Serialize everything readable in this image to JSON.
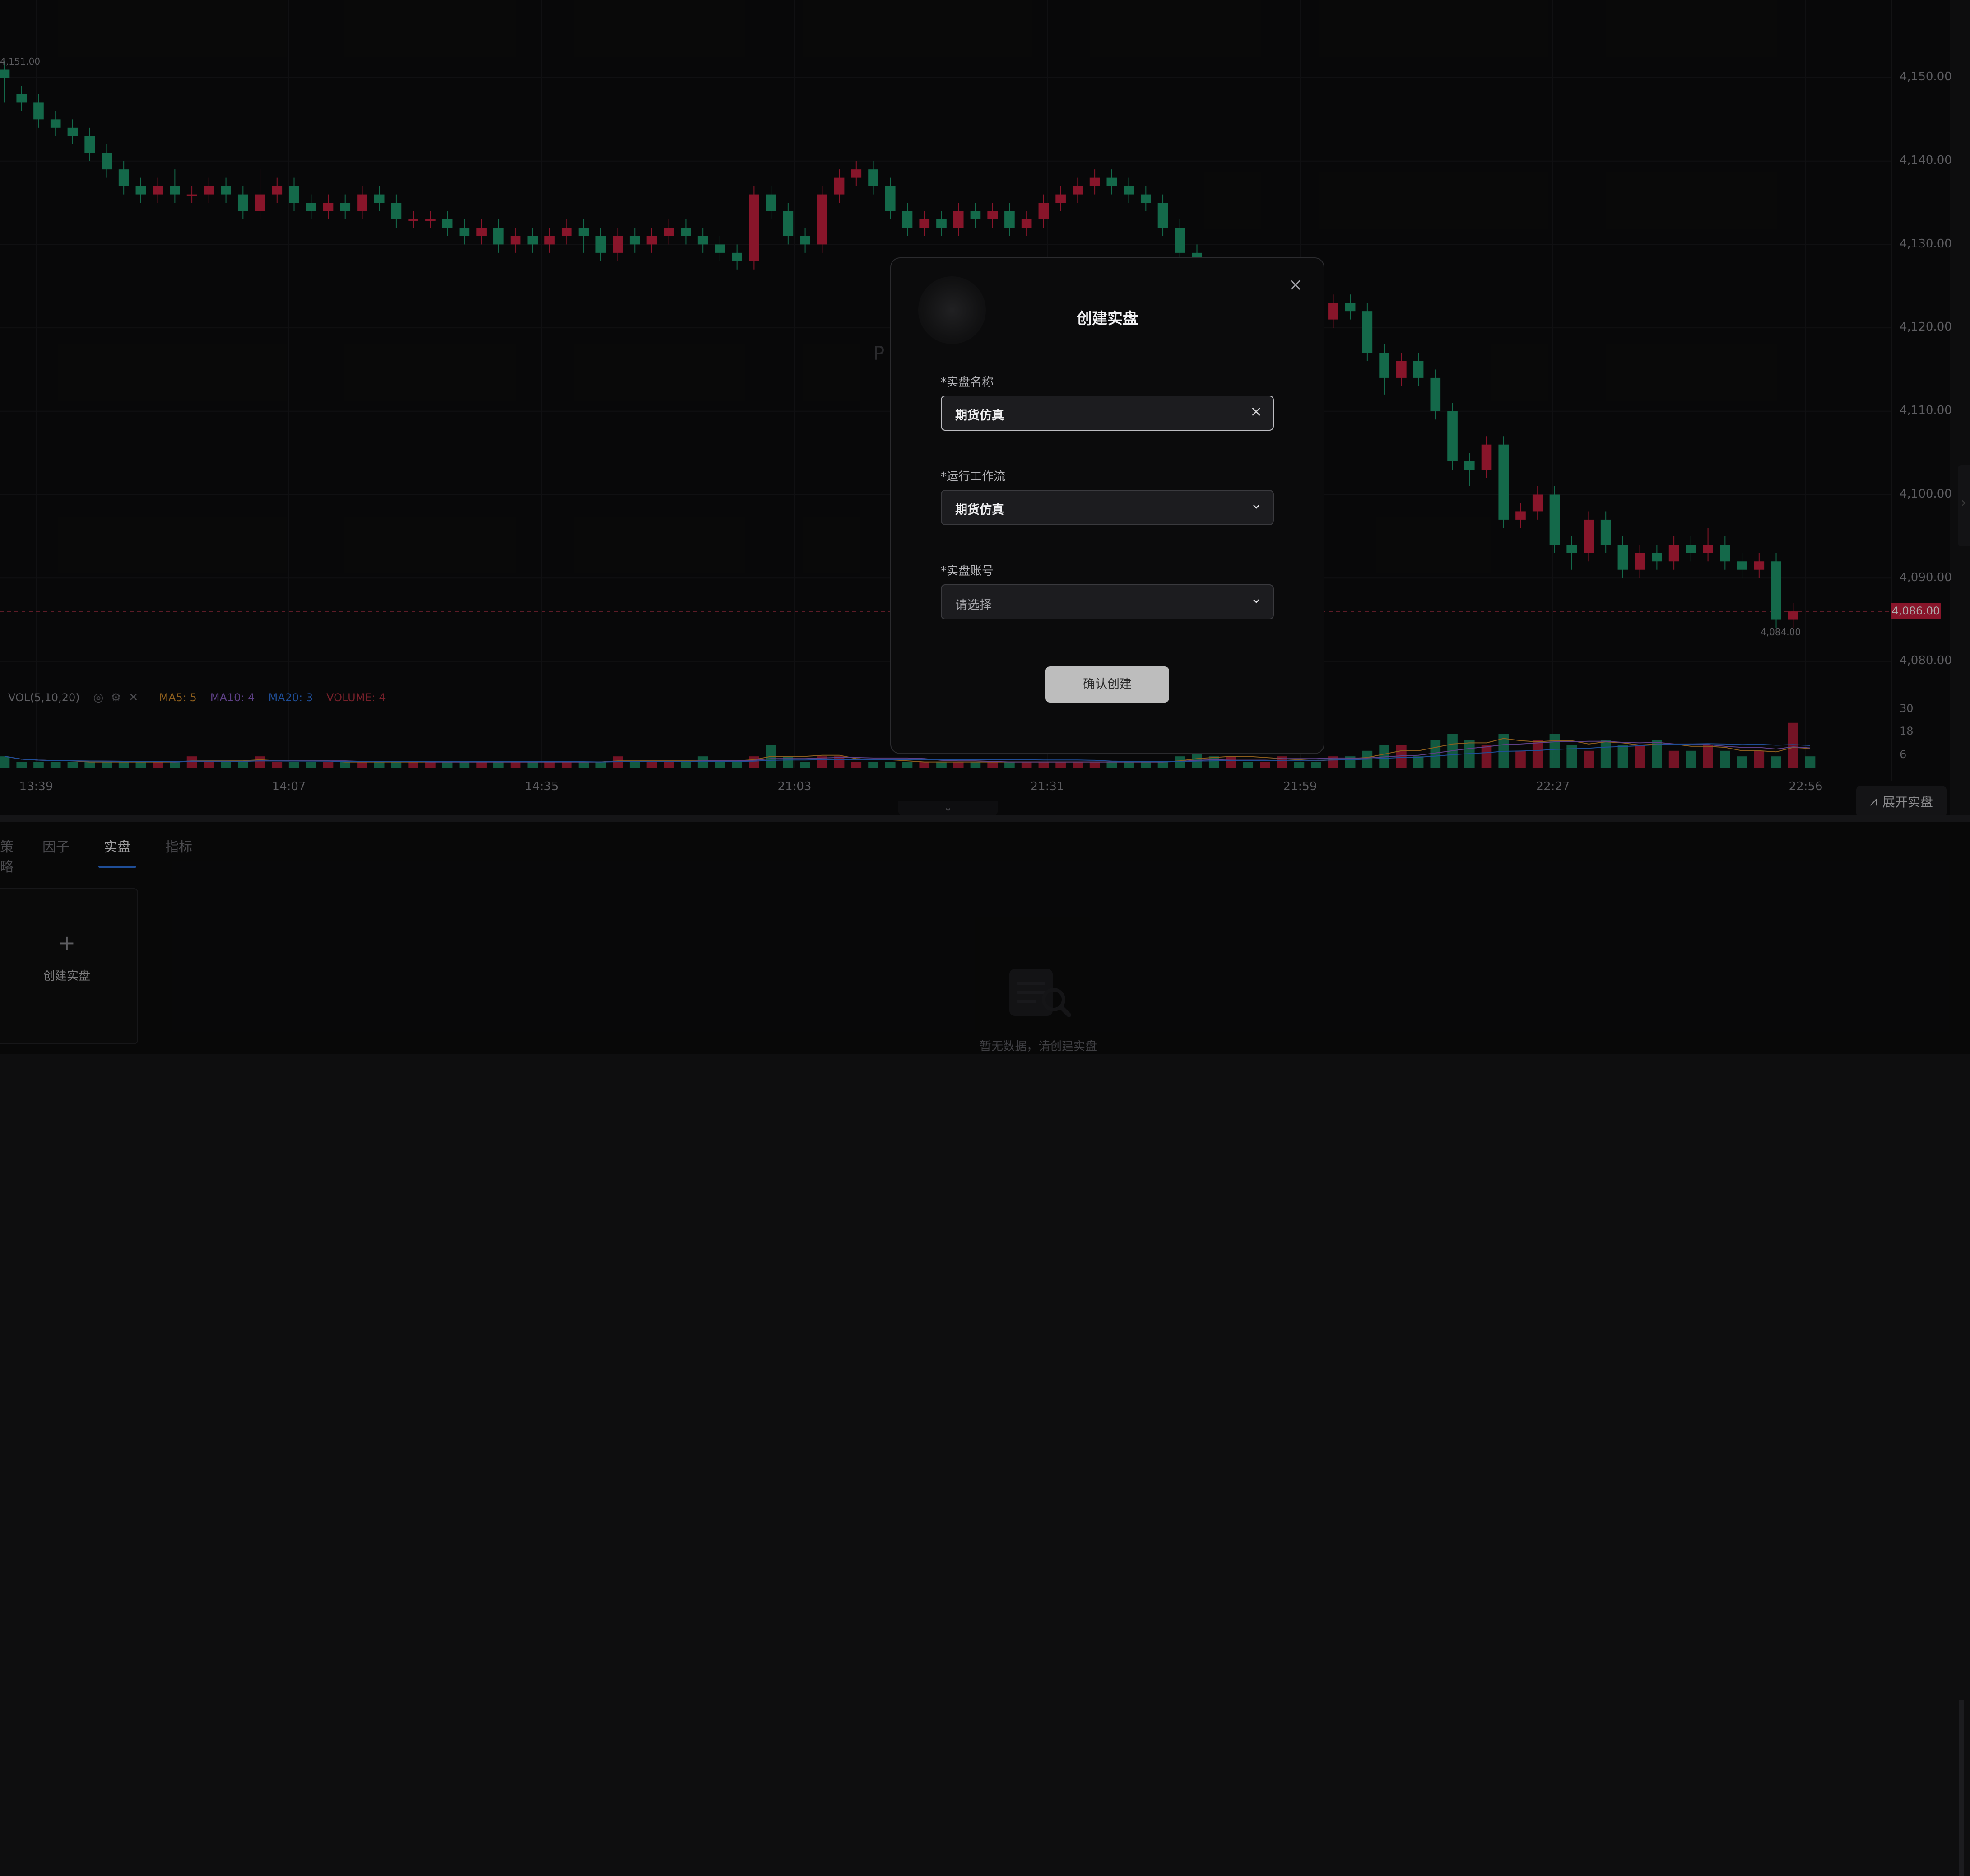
{
  "chart": {
    "high_tag": "4,151.00",
    "low_tag": "4,084.00",
    "current_price": "4,086.00",
    "y_axis": [
      "4,150.00",
      "4,140.00",
      "4,130.00",
      "4,120.00",
      "4,110.00",
      "4,100.00",
      "4,090.00",
      "4,080.00"
    ],
    "x_axis": [
      "13:39",
      "14:07",
      "14:35",
      "21:03",
      "21:31",
      "21:59",
      "22:27",
      "22:56"
    ],
    "volume_y_axis": [
      "30",
      "18",
      "6"
    ],
    "volume_legend": {
      "title": "VOL(5,10,20)",
      "ma5": "MA5: 5",
      "ma10": "MA10: 4",
      "ma20": "MA20: 3",
      "volume": "VOLUME: 4"
    },
    "colors": {
      "up": "#c9203e",
      "down": "#1e9b6e",
      "ma5": "#d08b2c",
      "ma10": "#8b5fc7",
      "ma20": "#2f74e0",
      "volume": "#b0303f"
    },
    "candles": [
      [
        4151,
        4150,
        4152,
        4147
      ],
      [
        4148,
        4147,
        4149,
        4146
      ],
      [
        4147,
        4145,
        4148,
        4144
      ],
      [
        4145,
        4144,
        4146,
        4143
      ],
      [
        4144,
        4143,
        4145,
        4142
      ],
      [
        4143,
        4141,
        4144,
        4140
      ],
      [
        4141,
        4139,
        4142,
        4138
      ],
      [
        4139,
        4137,
        4140,
        4136
      ],
      [
        4137,
        4136,
        4138,
        4135
      ],
      [
        4136,
        4137,
        4138,
        4135
      ],
      [
        4137,
        4136,
        4139,
        4135
      ],
      [
        4136,
        4136,
        4137,
        4135
      ],
      [
        4136,
        4137,
        4138,
        4135
      ],
      [
        4137,
        4136,
        4138,
        4135
      ],
      [
        4136,
        4134,
        4137,
        4133
      ],
      [
        4134,
        4136,
        4139,
        4133
      ],
      [
        4136,
        4137,
        4138,
        4135
      ],
      [
        4137,
        4135,
        4138,
        4134
      ],
      [
        4135,
        4134,
        4136,
        4133
      ],
      [
        4134,
        4135,
        4136,
        4133
      ],
      [
        4135,
        4134,
        4136,
        4133
      ],
      [
        4134,
        4136,
        4137,
        4133
      ],
      [
        4136,
        4135,
        4137,
        4134
      ],
      [
        4135,
        4133,
        4136,
        4132
      ],
      [
        4133,
        4133,
        4134,
        4132
      ],
      [
        4133,
        4133,
        4134,
        4132
      ],
      [
        4133,
        4132,
        4134,
        4131
      ],
      [
        4132,
        4131,
        4133,
        4130
      ],
      [
        4131,
        4132,
        4133,
        4130
      ],
      [
        4132,
        4130,
        4133,
        4129
      ],
      [
        4130,
        4131,
        4132,
        4129
      ],
      [
        4131,
        4130,
        4132,
        4129
      ],
      [
        4130,
        4131,
        4132,
        4129
      ],
      [
        4131,
        4132,
        4133,
        4130
      ],
      [
        4132,
        4131,
        4133,
        4129
      ],
      [
        4131,
        4129,
        4132,
        4128
      ],
      [
        4129,
        4131,
        4132,
        4128
      ],
      [
        4131,
        4130,
        4132,
        4129
      ],
      [
        4130,
        4131,
        4132,
        4129
      ],
      [
        4131,
        4132,
        4133,
        4130
      ],
      [
        4132,
        4131,
        4133,
        4130
      ],
      [
        4131,
        4130,
        4132,
        4129
      ],
      [
        4130,
        4129,
        4131,
        4128
      ],
      [
        4129,
        4128,
        4130,
        4127
      ],
      [
        4128,
        4136,
        4137,
        4127
      ],
      [
        4136,
        4134,
        4137,
        4133
      ],
      [
        4134,
        4131,
        4135,
        4130
      ],
      [
        4131,
        4130,
        4132,
        4129
      ],
      [
        4130,
        4136,
        4137,
        4129
      ],
      [
        4136,
        4138,
        4139,
        4135
      ],
      [
        4138,
        4139,
        4140,
        4137
      ],
      [
        4139,
        4137,
        4140,
        4136
      ],
      [
        4137,
        4134,
        4138,
        4133
      ],
      [
        4134,
        4132,
        4135,
        4131
      ],
      [
        4132,
        4133,
        4134,
        4131
      ],
      [
        4133,
        4132,
        4134,
        4131
      ],
      [
        4132,
        4134,
        4135,
        4131
      ],
      [
        4134,
        4133,
        4135,
        4132
      ],
      [
        4133,
        4134,
        4135,
        4132
      ],
      [
        4134,
        4132,
        4135,
        4131
      ],
      [
        4132,
        4133,
        4134,
        4131
      ],
      [
        4133,
        4135,
        4136,
        4132
      ],
      [
        4135,
        4136,
        4137,
        4134
      ],
      [
        4136,
        4137,
        4138,
        4135
      ],
      [
        4137,
        4138,
        4139,
        4136
      ],
      [
        4138,
        4137,
        4139,
        4136
      ],
      [
        4137,
        4136,
        4138,
        4135
      ],
      [
        4136,
        4135,
        4137,
        4134
      ],
      [
        4135,
        4132,
        4136,
        4131
      ],
      [
        4132,
        4129,
        4133,
        4126
      ],
      [
        4129,
        4124,
        4130,
        4123
      ],
      [
        4124,
        4121,
        4125,
        4120
      ],
      [
        4121,
        4122,
        4123,
        4120
      ],
      [
        4122,
        4120,
        4123,
        4119
      ],
      [
        4120,
        4121,
        4123,
        4119
      ],
      [
        4121,
        4123,
        4124,
        4120
      ],
      [
        4123,
        4122,
        4124,
        4121
      ],
      [
        4122,
        4121,
        4123,
        4120
      ],
      [
        4121,
        4123,
        4124,
        4120
      ],
      [
        4123,
        4122,
        4124,
        4121
      ],
      [
        4122,
        4117,
        4123,
        4116
      ],
      [
        4117,
        4114,
        4118,
        4112
      ],
      [
        4114,
        4116,
        4117,
        4113
      ],
      [
        4116,
        4114,
        4117,
        4113
      ],
      [
        4114,
        4110,
        4115,
        4109
      ],
      [
        4110,
        4104,
        4111,
        4103
      ],
      [
        4104,
        4103,
        4105,
        4101
      ],
      [
        4103,
        4106,
        4107,
        4102
      ],
      [
        4106,
        4097,
        4107,
        4096
      ],
      [
        4097,
        4098,
        4099,
        4096
      ],
      [
        4098,
        4100,
        4101,
        4097
      ],
      [
        4100,
        4094,
        4101,
        4093
      ],
      [
        4094,
        4093,
        4095,
        4091
      ],
      [
        4093,
        4097,
        4098,
        4092
      ],
      [
        4097,
        4094,
        4098,
        4093
      ],
      [
        4094,
        4091,
        4095,
        4090
      ],
      [
        4091,
        4093,
        4094,
        4090
      ],
      [
        4093,
        4092,
        4094,
        4091
      ],
      [
        4092,
        4094,
        4095,
        4091
      ],
      [
        4094,
        4093,
        4095,
        4092
      ],
      [
        4093,
        4094,
        4096,
        4092
      ],
      [
        4094,
        4092,
        4095,
        4091
      ],
      [
        4092,
        4091,
        4093,
        4090
      ],
      [
        4091,
        4092,
        4093,
        4090
      ],
      [
        4092,
        4085,
        4093,
        4084
      ],
      [
        4085,
        4086,
        4087,
        4084
      ]
    ],
    "volumes": [
      2,
      1,
      1,
      1,
      1,
      1,
      1,
      1,
      1,
      1,
      1,
      2,
      1,
      1,
      1,
      2,
      1,
      1,
      1,
      1,
      1,
      1,
      1,
      1,
      1,
      1,
      1,
      1,
      1,
      1,
      1,
      1,
      1,
      1,
      1,
      1,
      2,
      1,
      1,
      1,
      1,
      2,
      1,
      1,
      2,
      4,
      2,
      1,
      2,
      2,
      1,
      1,
      1,
      1,
      1,
      1,
      1,
      1,
      1,
      1,
      1,
      1,
      1,
      1,
      1,
      1,
      1,
      1,
      1,
      2,
      3,
      2,
      2,
      1,
      1,
      2,
      1,
      1,
      2,
      2,
      3,
      4,
      4,
      2,
      5,
      6,
      5,
      4,
      6,
      3,
      5,
      6,
      4,
      3,
      5,
      4,
      4,
      5,
      3,
      3,
      4,
      3,
      2,
      3,
      2,
      8,
      2
    ]
  },
  "bottom": {
    "tabs": [
      "策略",
      "因子",
      "实盘",
      "指标"
    ],
    "active_tab": "实盘",
    "create_card_plus": "+",
    "create_card_label": "创建实盘",
    "empty_text": "暂无数据，请创建实盘",
    "expand_button": "展开实盘"
  },
  "modal": {
    "title": "创建实盘",
    "close": "×",
    "ghost_text": "P",
    "fields": [
      {
        "label": "*实盘名称",
        "value": "期货仿真",
        "type": "input"
      },
      {
        "label": "*运行工作流",
        "value": "期货仿真",
        "type": "select"
      },
      {
        "label": "*实盘账号",
        "placeholder": "请选择",
        "type": "select"
      }
    ],
    "confirm_label": "确认创建"
  }
}
